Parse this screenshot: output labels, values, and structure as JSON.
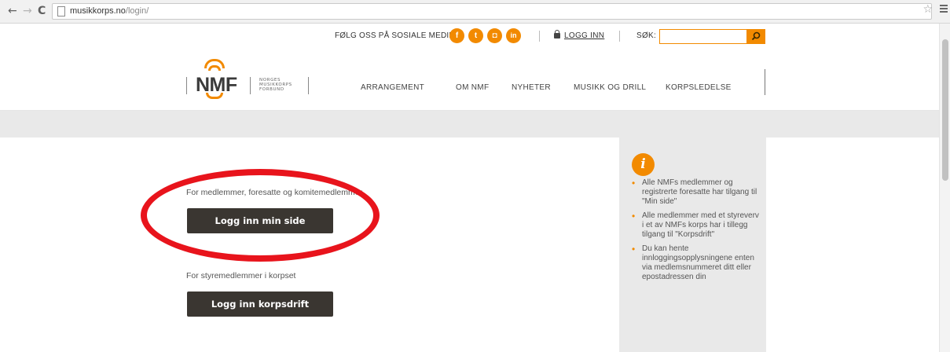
{
  "browser": {
    "back": "←",
    "forward": "→",
    "reload": "C",
    "url_host": "musikkorps.no",
    "url_path": "/login/"
  },
  "topbar": {
    "follow_text": "FØLG OSS PÅ SOSIALE MEDIER:",
    "social": [
      {
        "name": "facebook",
        "glyph": "f"
      },
      {
        "name": "twitter",
        "glyph": "t"
      },
      {
        "name": "instagram",
        "glyph": "◘"
      },
      {
        "name": "linkedin",
        "glyph": "in"
      }
    ],
    "login_label": "LOGG INN",
    "search_label": "SØK:",
    "search_value": ""
  },
  "header": {
    "logo_text": "NMF",
    "logo_sub_lines": [
      "NORGES",
      "MUSIKKORPS",
      "FORBUND"
    ],
    "nav": [
      "ARRANGEMENT",
      "OM NMF",
      "NYHETER",
      "MUSIKK OG DRILL",
      "KORPSLEDELSE"
    ]
  },
  "main": {
    "members_label": "For medlemmer, foresatte og komitemedlemmer",
    "login_my_page": "Logg inn min side",
    "board_label": "For styremedlemmer i korpset",
    "login_korpsdrift": "Logg inn korpsdrift"
  },
  "infobox": {
    "icon_glyph": "i",
    "items": [
      "Alle NMFs medlemmer og registrerte foresatte har tilgang til \"Min side\"",
      "Alle medlemmer med et styreverv i et av NMFs korps har i tillegg tilgang til \"Korpsdrift\"",
      "Du kan hente innloggingsopplysningene enten via medlemsnummeret ditt eller epostadressen din"
    ]
  },
  "colors": {
    "accent": "#f28a00",
    "dark_button": "#3a3631",
    "annotation": "#e8141c"
  }
}
